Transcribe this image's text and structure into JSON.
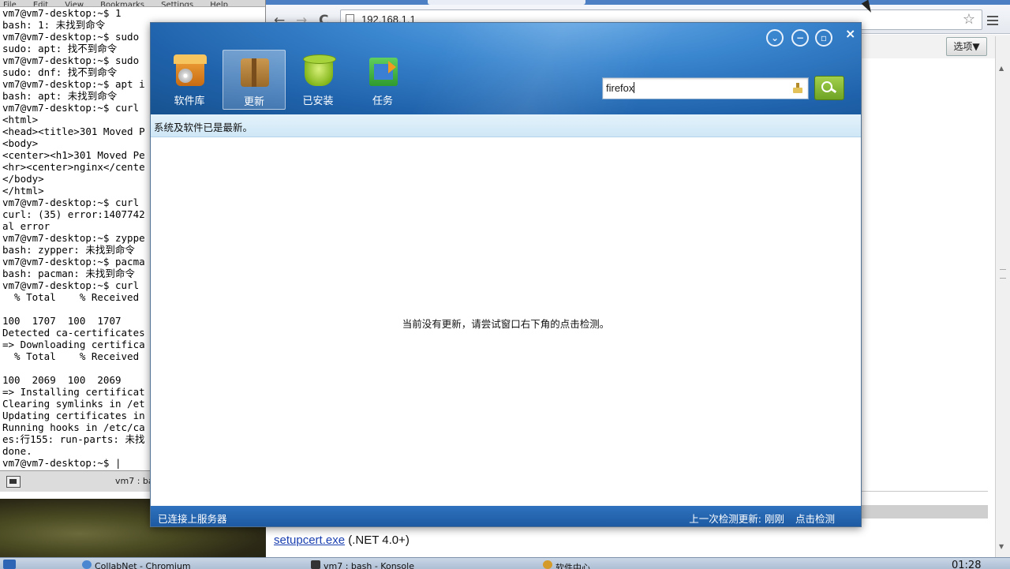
{
  "terminal": {
    "menu": [
      "File",
      "Edit",
      "View",
      "Bookmarks",
      "Settings",
      "Help"
    ],
    "lines": [
      "vm7@vm7-desktop:~$ 1",
      "bash: 1: 未找到命令",
      "vm7@vm7-desktop:~$ sudo",
      "sudo: apt: 找不到命令",
      "vm7@vm7-desktop:~$ sudo",
      "sudo: dnf: 找不到命令",
      "vm7@vm7-desktop:~$ apt i",
      "bash: apt: 未找到命令",
      "vm7@vm7-desktop:~$ curl",
      "<html>",
      "<head><title>301 Moved P",
      "<body>",
      "<center><h1>301 Moved Pe",
      "<hr><center>nginx</cente",
      "</body>",
      "</html>",
      "vm7@vm7-desktop:~$ curl",
      "curl: (35) error:1407742",
      "al error",
      "vm7@vm7-desktop:~$ zyppe",
      "bash: zypper: 未找到命令",
      "vm7@vm7-desktop:~$ pacma",
      "bash: pacman: 未找到命令",
      "vm7@vm7-desktop:~$ curl",
      "  % Total    % Received",
      "",
      "100  1707  100  1707",
      "Detected ca-certificates",
      "=> Downloading certifica",
      "  % Total    % Received",
      "",
      "100  2069  100  2069",
      "=> Installing certificat",
      "Clearing symlinks in /et",
      "Updating certificates in",
      "Running hooks in /etc/ca",
      "es:行155: run-parts: 未找",
      "done.",
      "vm7@vm7-desktop:~$ |"
    ],
    "tab_label": "vm7 : ba"
  },
  "browser": {
    "url": "192.168.1.1",
    "options_label": "选项▼",
    "setup_link": "setupcert.exe",
    "setup_suffix": " (.NET 4.0+)",
    "nav": {
      "back": "←",
      "forward": "→",
      "reload": "C",
      "star": "☆"
    }
  },
  "software_center": {
    "window_controls": {
      "down": "⌄",
      "minimize": "−",
      "restore": "▫",
      "close": "×"
    },
    "nav": [
      {
        "label": "软件库",
        "icon": "software-store-icon"
      },
      {
        "label": "更新",
        "icon": "update-box-icon"
      },
      {
        "label": "已安装",
        "icon": "installed-jar-icon"
      },
      {
        "label": "任务",
        "icon": "tasks-icon"
      }
    ],
    "active_nav": "更新",
    "search": {
      "value": "firefox"
    },
    "info_bar": "系统及软件已是最新。",
    "empty_message": "当前没有更新，请尝试窗口右下角的点击检测。",
    "footer": {
      "status": "已连接上服务器",
      "last_check_label": "上一次检测更新:",
      "last_check_value": "刚刚",
      "check_link": "点击检测"
    }
  },
  "taskbar": {
    "items": [
      "CollabNet - Chromium",
      "vm7 : bash - Konsole",
      "软件中心"
    ],
    "clock": "01:28"
  },
  "colors": {
    "header_blue": "#2a73c0",
    "footer_blue": "#2463ad",
    "info_bar": "#d9edf9",
    "search_green": "#86bb35"
  }
}
